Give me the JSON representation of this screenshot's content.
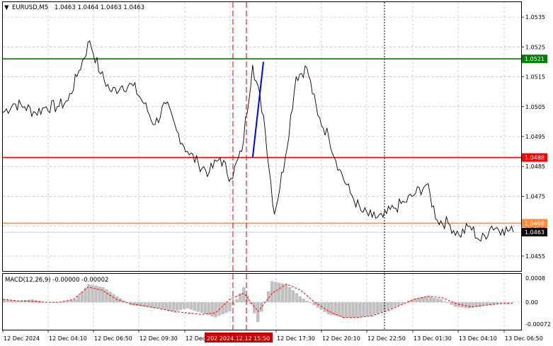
{
  "header": {
    "menu_arrow": "▼",
    "symbol": "EURUSD,M5",
    "ohlc": "1.0463 1.0464 1.0463 1.0463"
  },
  "macd": {
    "label": "MACD(12,26,9) -0.00000 -0.00002",
    "ticks": [
      "0.0008",
      "0.00",
      "-0.00072"
    ]
  },
  "price_axis": {
    "ticks": [
      "1.0535",
      "1.0525",
      "1.0515",
      "1.0505",
      "1.0495",
      "1.0485",
      "1.0475",
      "1.0465",
      "1.0455"
    ]
  },
  "levels": [
    {
      "price": 1.0521,
      "label": "1.0521",
      "color": "#008000",
      "tag_text_color": "#ffffff"
    },
    {
      "price": 1.0488,
      "label": "1.0488",
      "color": "#ff0000",
      "tag_text_color": "#ffffff"
    },
    {
      "price": 1.0466,
      "label": "1.0466",
      "color": "#ff8c3c",
      "tag_text_color": "#ffffff"
    },
    {
      "price": 1.0463,
      "label": "1.0463",
      "color": "#c0c0c0",
      "tag_text_color": "#ffffff",
      "current": true
    }
  ],
  "time_axis": {
    "labels": [
      "12 Dec 2024",
      "12 Dec 04:10",
      "12 Dec 06:50",
      "12 Dec 09:30",
      "12 Dec",
      "12 Dec 17:30",
      "12 Dec 20:10",
      "12 Dec 22:50",
      "13 Dec 01:30",
      "13 Dec 04:10",
      "13 Dec 06:50"
    ],
    "highlight": "202 2024.12.12 15:50"
  },
  "colors": {
    "price_line": "#000000",
    "grid": "#c0c0c0",
    "signal_line": "#ff0000",
    "histogram": "#c0c0c0",
    "trend_line": "#0000ff",
    "crosshair": "#cc0000",
    "highlight_bg": "#cc0000"
  },
  "chart_data": {
    "type": "line",
    "title": "EURUSD,M5",
    "x": [
      "12 Dec 2024 01:30",
      "12 Dec 02:20",
      "12 Dec 03:10",
      "12 Dec 04:10",
      "12 Dec 05:00",
      "12 Dec 05:50",
      "12 Dec 06:50",
      "12 Dec 07:10",
      "12 Dec 07:30",
      "12 Dec 08:00",
      "12 Dec 08:40",
      "12 Dec 09:30",
      "12 Dec 10:20",
      "12 Dec 11:00",
      "12 Dec 11:40",
      "12 Dec 12:20",
      "12 Dec 13:00",
      "12 Dec 13:40",
      "12 Dec 14:10",
      "12 Dec 14:30",
      "12 Dec 14:50",
      "12 Dec 15:10",
      "12 Dec 15:30",
      "12 Dec 15:50",
      "12 Dec 16:10",
      "12 Dec 16:30",
      "12 Dec 16:50",
      "12 Dec 17:10",
      "12 Dec 17:30",
      "12 Dec 18:10",
      "12 Dec 18:50",
      "12 Dec 19:30",
      "12 Dec 20:10",
      "12 Dec 20:50",
      "12 Dec 21:30",
      "12 Dec 22:10",
      "12 Dec 22:50",
      "12 Dec 23:50",
      "13 Dec 00:40",
      "13 Dec 01:30",
      "13 Dec 02:10",
      "13 Dec 02:50",
      "13 Dec 03:30",
      "13 Dec 04:10",
      "13 Dec 04:50",
      "13 Dec 05:30",
      "13 Dec 06:10",
      "13 Dec 06:50"
    ],
    "series": [
      {
        "values": [
          1.0503,
          1.0506,
          1.0505,
          1.0503,
          1.0505,
          1.0505,
          1.0507,
          1.0517,
          1.0527,
          1.0516,
          1.051,
          1.0512,
          1.0512,
          1.0506,
          1.0499,
          1.0506,
          1.0497,
          1.049,
          1.0486,
          1.0483,
          1.0488,
          1.0481,
          1.049,
          1.0519,
          1.0502,
          1.0469,
          1.0488,
          1.0515,
          1.0518,
          1.0502,
          1.0495,
          1.0484,
          1.0476,
          1.047,
          1.0468,
          1.0468,
          1.0471,
          1.0473,
          1.0476,
          1.0479,
          1.0467,
          1.0466,
          1.0462,
          1.0465,
          1.046,
          1.0465,
          1.0464,
          1.0463
        ]
      }
    ],
    "ylim": [
      1.045,
      1.054
    ],
    "yticks": [
      1.0535,
      1.0525,
      1.0515,
      1.0505,
      1.0495,
      1.0485,
      1.0475,
      1.0465,
      1.0455
    ],
    "horizontal_levels": [
      1.0521,
      1.0488,
      1.0466,
      1.0463
    ],
    "trend_line": {
      "from": {
        "x": "12 Dec 15:50",
        "y": 1.0488
      },
      "to": {
        "x": "12 Dec 16:40",
        "y": 1.052
      }
    },
    "grid": true,
    "macd": {
      "params": "12,26,9",
      "main": -0.0,
      "signal": -2e-05,
      "ylim": [
        -0.00072,
        0.0008
      ],
      "histogram": [
        0.0001,
        5e-05,
        0.0001,
        0.0,
        0.0,
        0.0001,
        0.0006,
        0.0005,
        0.0002,
        -0.0001,
        -0.00015,
        -0.0002,
        -0.0003,
        -0.0002,
        -0.00035,
        -0.0005,
        -0.0003,
        0.0005,
        -0.00065,
        0.0007,
        0.0006,
        0.0002,
        -0.0001,
        -0.0004,
        -0.0005,
        -0.0005,
        -0.00045,
        -0.0003,
        -0.0001,
        0.0001,
        0.0002,
        0.0001,
        -0.00015,
        -0.0002,
        -0.00012,
        -5e-05,
        0.0
      ],
      "signal_line": [
        0.0001,
        5e-05,
        3e-05,
        0.0,
        0.0,
        0.0001,
        0.0005,
        0.0004,
        0.0001,
        -5e-05,
        -0.00012,
        -0.0002,
        -0.0003,
        -0.00035,
        -0.0004,
        -0.00035,
        0.0001,
        0.0003,
        -0.0003,
        0.0003,
        0.0006,
        0.0004,
        0.0,
        -0.0003,
        -0.0005,
        -0.0005,
        -0.00045,
        -0.0003,
        -0.0001,
        0.0001,
        0.0002,
        0.00015,
        -5e-05,
        -0.00015,
        -0.0001,
        -5e-05,
        -2e-05
      ]
    }
  }
}
